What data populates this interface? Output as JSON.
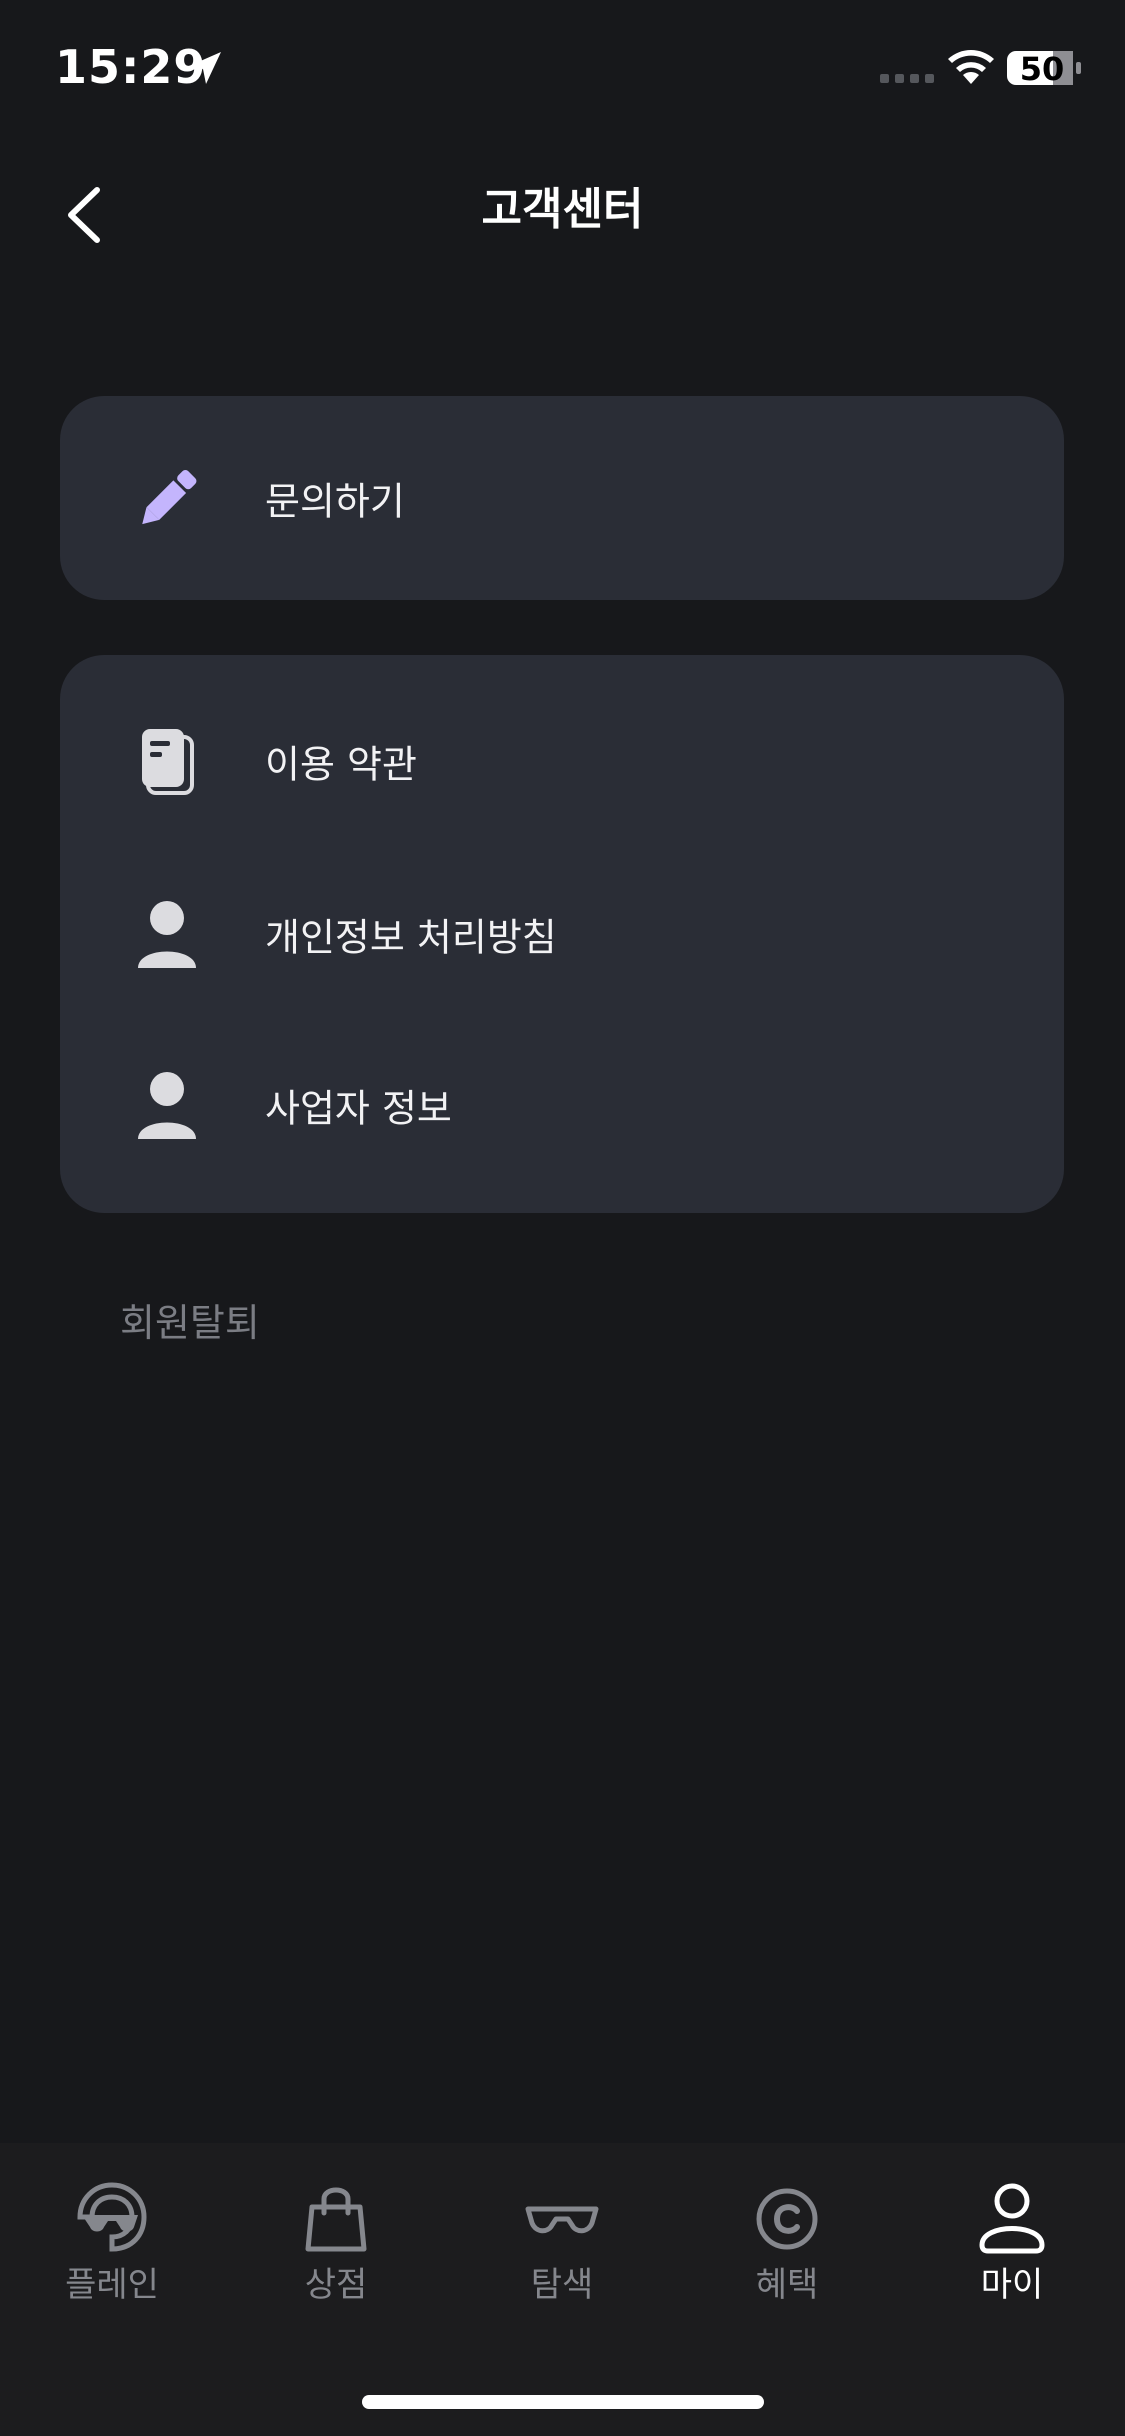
{
  "status_bar": {
    "time": "15:29",
    "battery": "50"
  },
  "header": {
    "title": "고객센터",
    "back_icon": "chevron-left-icon"
  },
  "menu_groups": [
    {
      "items": [
        {
          "label": "문의하기",
          "icon": "pencil-icon",
          "icon_color": "#c4b5fd"
        }
      ]
    },
    {
      "items": [
        {
          "label": "이용 약관",
          "icon": "document-icon"
        },
        {
          "label": "개인정보 처리방침",
          "icon": "person-icon"
        },
        {
          "label": "사업자 정보",
          "icon": "person-icon"
        }
      ]
    }
  ],
  "withdraw_label": "회원탈퇴",
  "tab_bar": {
    "tabs": [
      {
        "label": "플레인",
        "icon": "avatar-glasses-icon",
        "active": false
      },
      {
        "label": "상점",
        "icon": "shopping-bag-icon",
        "active": false
      },
      {
        "label": "탐색",
        "icon": "glasses-icon",
        "active": false
      },
      {
        "label": "혜택",
        "icon": "coin-icon",
        "active": false
      },
      {
        "label": "마이",
        "icon": "profile-icon",
        "active": true
      }
    ]
  },
  "colors": {
    "background": "#17181b",
    "card": "#2a2d36",
    "accent": "#c4b5fd",
    "tab_inactive": "#85878d",
    "tab_active": "#ffffff"
  }
}
